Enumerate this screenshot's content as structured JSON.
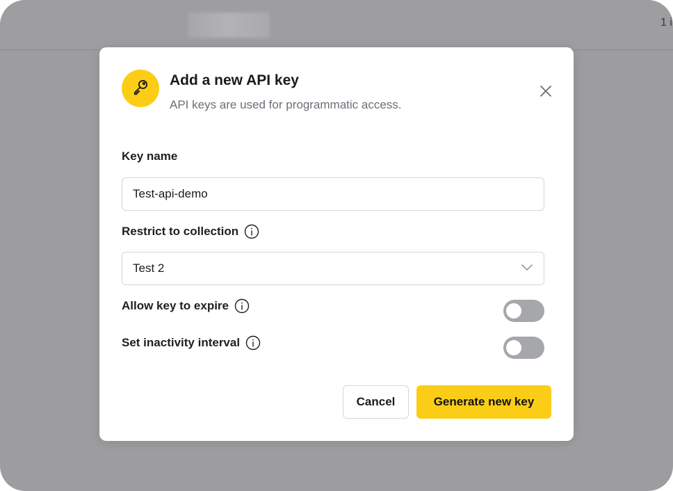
{
  "background": {
    "corner_text": "1 i"
  },
  "modal": {
    "title": "Add a new API key",
    "subtitle": "API keys are used for programmatic access.",
    "key_name_label": "Key name",
    "key_name_value": "Test-api-demo",
    "collection_label": "Restrict to collection",
    "collection_value": "Test 2",
    "expire_label": "Allow key to expire",
    "expire_enabled": false,
    "inactivity_label": "Set inactivity interval",
    "inactivity_enabled": false,
    "cancel_label": "Cancel",
    "generate_label": "Generate new key"
  },
  "colors": {
    "accent": "#fccd17",
    "overlay": "#9d9d9f",
    "toggle_off": "#a6a7ab",
    "subtitle": "#6b6f76"
  },
  "icons": {
    "header": "key-icon",
    "close": "close-icon",
    "info": "info-icon",
    "dropdown": "chevron-down-icon"
  }
}
